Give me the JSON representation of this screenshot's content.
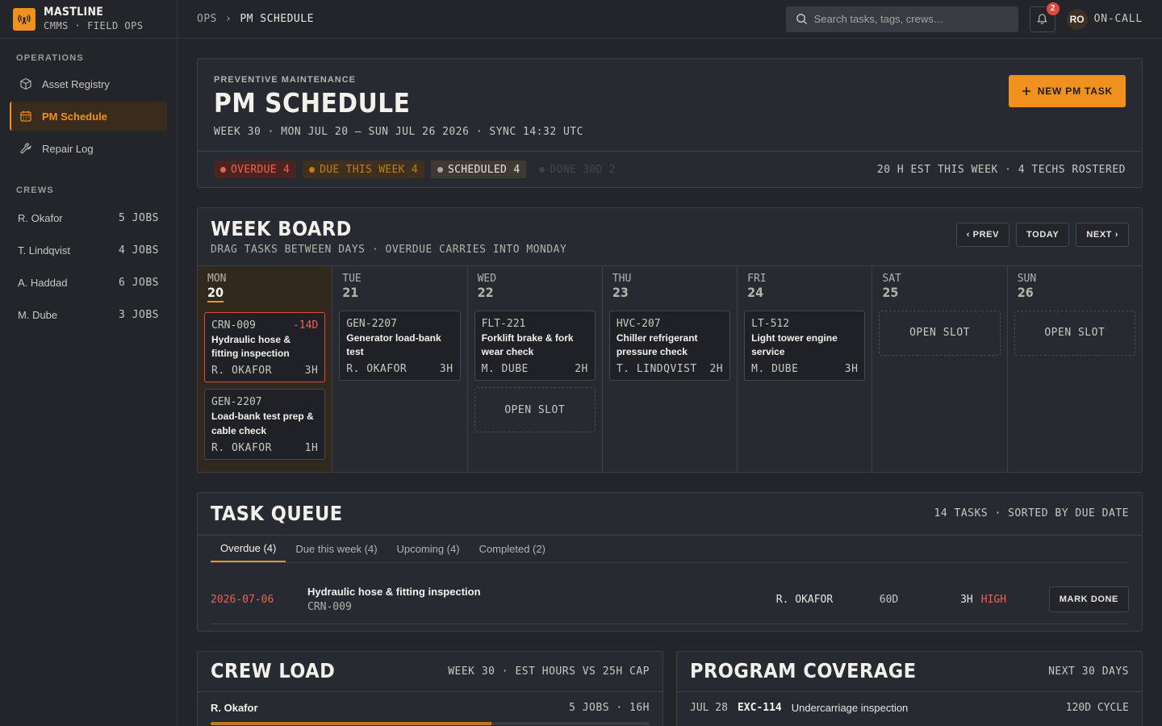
{
  "brand": {
    "name": "MASTLINE",
    "sub": "CMMS · FIELD OPS",
    "accent": "#f0901e"
  },
  "sidebar": {
    "operations_title": "OPERATIONS",
    "nav": [
      {
        "label": "Asset Registry",
        "icon": "cube-icon"
      },
      {
        "label": "PM Schedule",
        "icon": "calendar-icon",
        "active": true
      },
      {
        "label": "Repair Log",
        "icon": "wrench-icon"
      }
    ],
    "crews_title": "CREWS",
    "crews": [
      {
        "name": "R. Okafor",
        "jobs": "5 JOBS"
      },
      {
        "name": "T. Lindqvist",
        "jobs": "4 JOBS"
      },
      {
        "name": "A. Haddad",
        "jobs": "6 JOBS"
      },
      {
        "name": "M. Dube",
        "jobs": "3 JOBS"
      }
    ]
  },
  "topbar": {
    "breadcrumb": [
      "OPS",
      "PM SCHEDULE"
    ],
    "search_placeholder": "Search tasks, tags, crews…",
    "notifications": "2",
    "user_initials": "RO",
    "user_status": "ON-CALL"
  },
  "header": {
    "eyebrow": "PREVENTIVE MAINTENANCE",
    "title": "PM SCHEDULE",
    "subtitle": "WEEK 30 · MON JUL 20 — SUN JUL 26 2026 · SYNC 14:32 UTC",
    "new_button": "NEW PM TASK",
    "chips": {
      "overdue": "OVERDUE 4",
      "due": "DUE THIS WEEK 4",
      "scheduled": "SCHEDULED 4",
      "done": "DONE 30D 2"
    },
    "meta": "20 H EST THIS WEEK · 4 TECHS ROSTERED"
  },
  "board": {
    "title": "WEEK BOARD",
    "subtitle": "DRAG TASKS BETWEEN DAYS · OVERDUE CARRIES INTO MONDAY",
    "prev": "‹ PREV",
    "today": "TODAY",
    "next": "NEXT ›",
    "open_slot": "OPEN SLOT",
    "days": [
      {
        "name": "MON",
        "num": "20",
        "tasks": [
          {
            "id": "CRN-009",
            "late": "-14D",
            "title": "Hydraulic hose & fitting inspection",
            "tech": "R. OKAFOR",
            "hrs": "3H"
          },
          {
            "id": "GEN-2207",
            "title": "Load-bank test prep & cable check",
            "tech": "R. OKAFOR",
            "hrs": "1H"
          }
        ]
      },
      {
        "name": "TUE",
        "num": "21",
        "tasks": [
          {
            "id": "GEN-2207",
            "title": "Generator load-bank test",
            "tech": "R. OKAFOR",
            "hrs": "3H"
          }
        ]
      },
      {
        "name": "WED",
        "num": "22",
        "tasks": [
          {
            "id": "FLT-221",
            "title": "Forklift brake & fork wear check",
            "tech": "M. DUBE",
            "hrs": "2H"
          }
        ]
      },
      {
        "name": "THU",
        "num": "23",
        "tasks": [
          {
            "id": "HVC-207",
            "title": "Chiller refrigerant pressure check",
            "tech": "T. LINDQVIST",
            "hrs": "2H"
          }
        ]
      },
      {
        "name": "FRI",
        "num": "24",
        "tasks": [
          {
            "id": "LT-512",
            "title": "Light tower engine service",
            "tech": "M. DUBE",
            "hrs": "3H"
          }
        ]
      },
      {
        "name": "SAT",
        "num": "25",
        "tasks": []
      },
      {
        "name": "SUN",
        "num": "26",
        "tasks": []
      }
    ]
  },
  "queue": {
    "title": "TASK QUEUE",
    "meta": "14 TASKS · SORTED BY DUE DATE",
    "tabs": [
      "Overdue (4)",
      "Due this week (4)",
      "Upcoming (4)",
      "Completed (2)"
    ],
    "row": {
      "date": "2026-07-06",
      "title": "Hydraulic hose & fitting inspection",
      "id": "CRN-009",
      "tech": "R. OKAFOR",
      "interval": "60D",
      "hrs": "3H",
      "priority": "HIGH",
      "action": "MARK DONE"
    }
  },
  "crew_load": {
    "title": "CREW LOAD",
    "meta": "WEEK 30 · EST HOURS VS 25H CAP",
    "rows": [
      {
        "name": "R. Okafor",
        "summary": "5 JOBS · 16H",
        "fraction": 0.64
      }
    ]
  },
  "coverage": {
    "title": "PROGRAM COVERAGE",
    "meta": "NEXT 30 DAYS",
    "rows": [
      {
        "date": "JUL 28",
        "id": "EXC-114",
        "title": "Undercarriage inspection",
        "cycle": "120D CYCLE"
      }
    ]
  }
}
